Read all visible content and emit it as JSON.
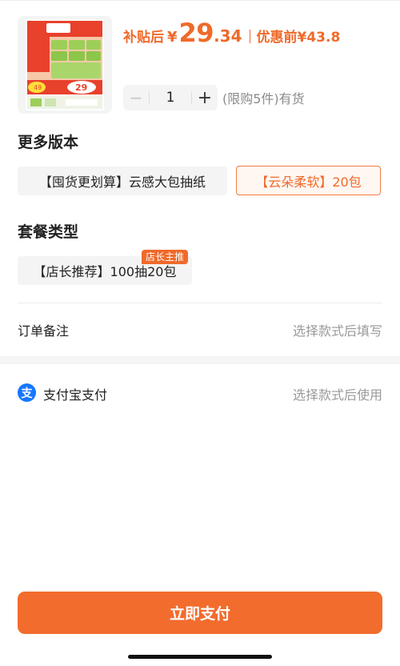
{
  "colors": {
    "accent": "#ef6a2a",
    "button": "#f26c2d",
    "alipay": "#1677ff"
  },
  "product": {
    "price_label": "补贴后",
    "currency": "¥",
    "price_int": "29",
    "price_dec": ".34",
    "orig_label": "优惠前",
    "orig_price": "¥43.8",
    "image": {
      "badge_left": "100抽大包",
      "badge_right": "量贩更耐用",
      "slogan": "柔软亲肤",
      "price_tag": "29",
      "old_price": "49"
    }
  },
  "quantity": {
    "minus": "−",
    "value": "1",
    "plus": "+",
    "stock": "(限购5件)有货"
  },
  "versions": {
    "title": "更多版本",
    "options": [
      {
        "label": "【囤货更划算】云感大包抽纸",
        "selected": false
      },
      {
        "label": "【云朵柔软】20包",
        "selected": true
      }
    ]
  },
  "package": {
    "title": "套餐类型",
    "badge": "店长主推",
    "options": [
      {
        "label": "【店长推荐】100抽20包"
      }
    ]
  },
  "remark": {
    "label": "订单备注",
    "value": "选择款式后填写"
  },
  "payment": {
    "icon": "alipay-icon",
    "icon_char": "支",
    "label": "支付宝支付",
    "value": "选择款式后使用"
  },
  "submit": {
    "label": "立即支付"
  }
}
